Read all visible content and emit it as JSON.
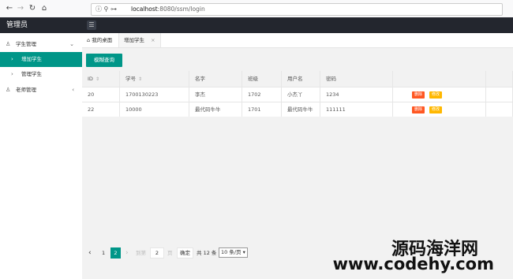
{
  "browser": {
    "url_host": "localhost",
    "url_rest": ":8080/ssm/login",
    "back_icon": "←",
    "forward_icon": "→",
    "reload_icon": "↻",
    "home_icon": "⌂"
  },
  "app": {
    "title": "管理员"
  },
  "sidebar": {
    "groups": [
      {
        "label": "学生管理",
        "expanded": true
      },
      {
        "label": "老师管理",
        "expanded": false
      }
    ],
    "items": [
      {
        "label": "增加学生",
        "active": true
      },
      {
        "label": "管理学生",
        "active": false
      }
    ]
  },
  "tabs": [
    {
      "label": "我的桌面"
    },
    {
      "label": "增加学生",
      "close": "×"
    }
  ],
  "toolbar": {
    "search_label": "模糊查询"
  },
  "table": {
    "headers": [
      "ID",
      "学号",
      "名字",
      "班级",
      "用户名",
      "密码",
      "",
      ""
    ],
    "rows": [
      {
        "id": "20",
        "student_no": "1700130223",
        "name": "李杰",
        "class": "1702",
        "username": "小杰丫",
        "password": "1234",
        "del": "删除",
        "edit": "修改"
      },
      {
        "id": "22",
        "student_no": "10000",
        "name": "最代码牛牛",
        "class": "1701",
        "username": "最代码牛牛",
        "password": "111111",
        "del": "删除",
        "edit": "修改"
      }
    ]
  },
  "pager": {
    "prev": "‹",
    "page1": "1",
    "page2": "2",
    "next": "›",
    "goto_label": "到第",
    "goto_value": "2",
    "page_unit": "页",
    "confirm": "确定",
    "total": "共 12 条",
    "per_page": "10 条/页"
  },
  "watermark": {
    "line1": "源码海洋网",
    "line2": "www.codehy.com"
  }
}
